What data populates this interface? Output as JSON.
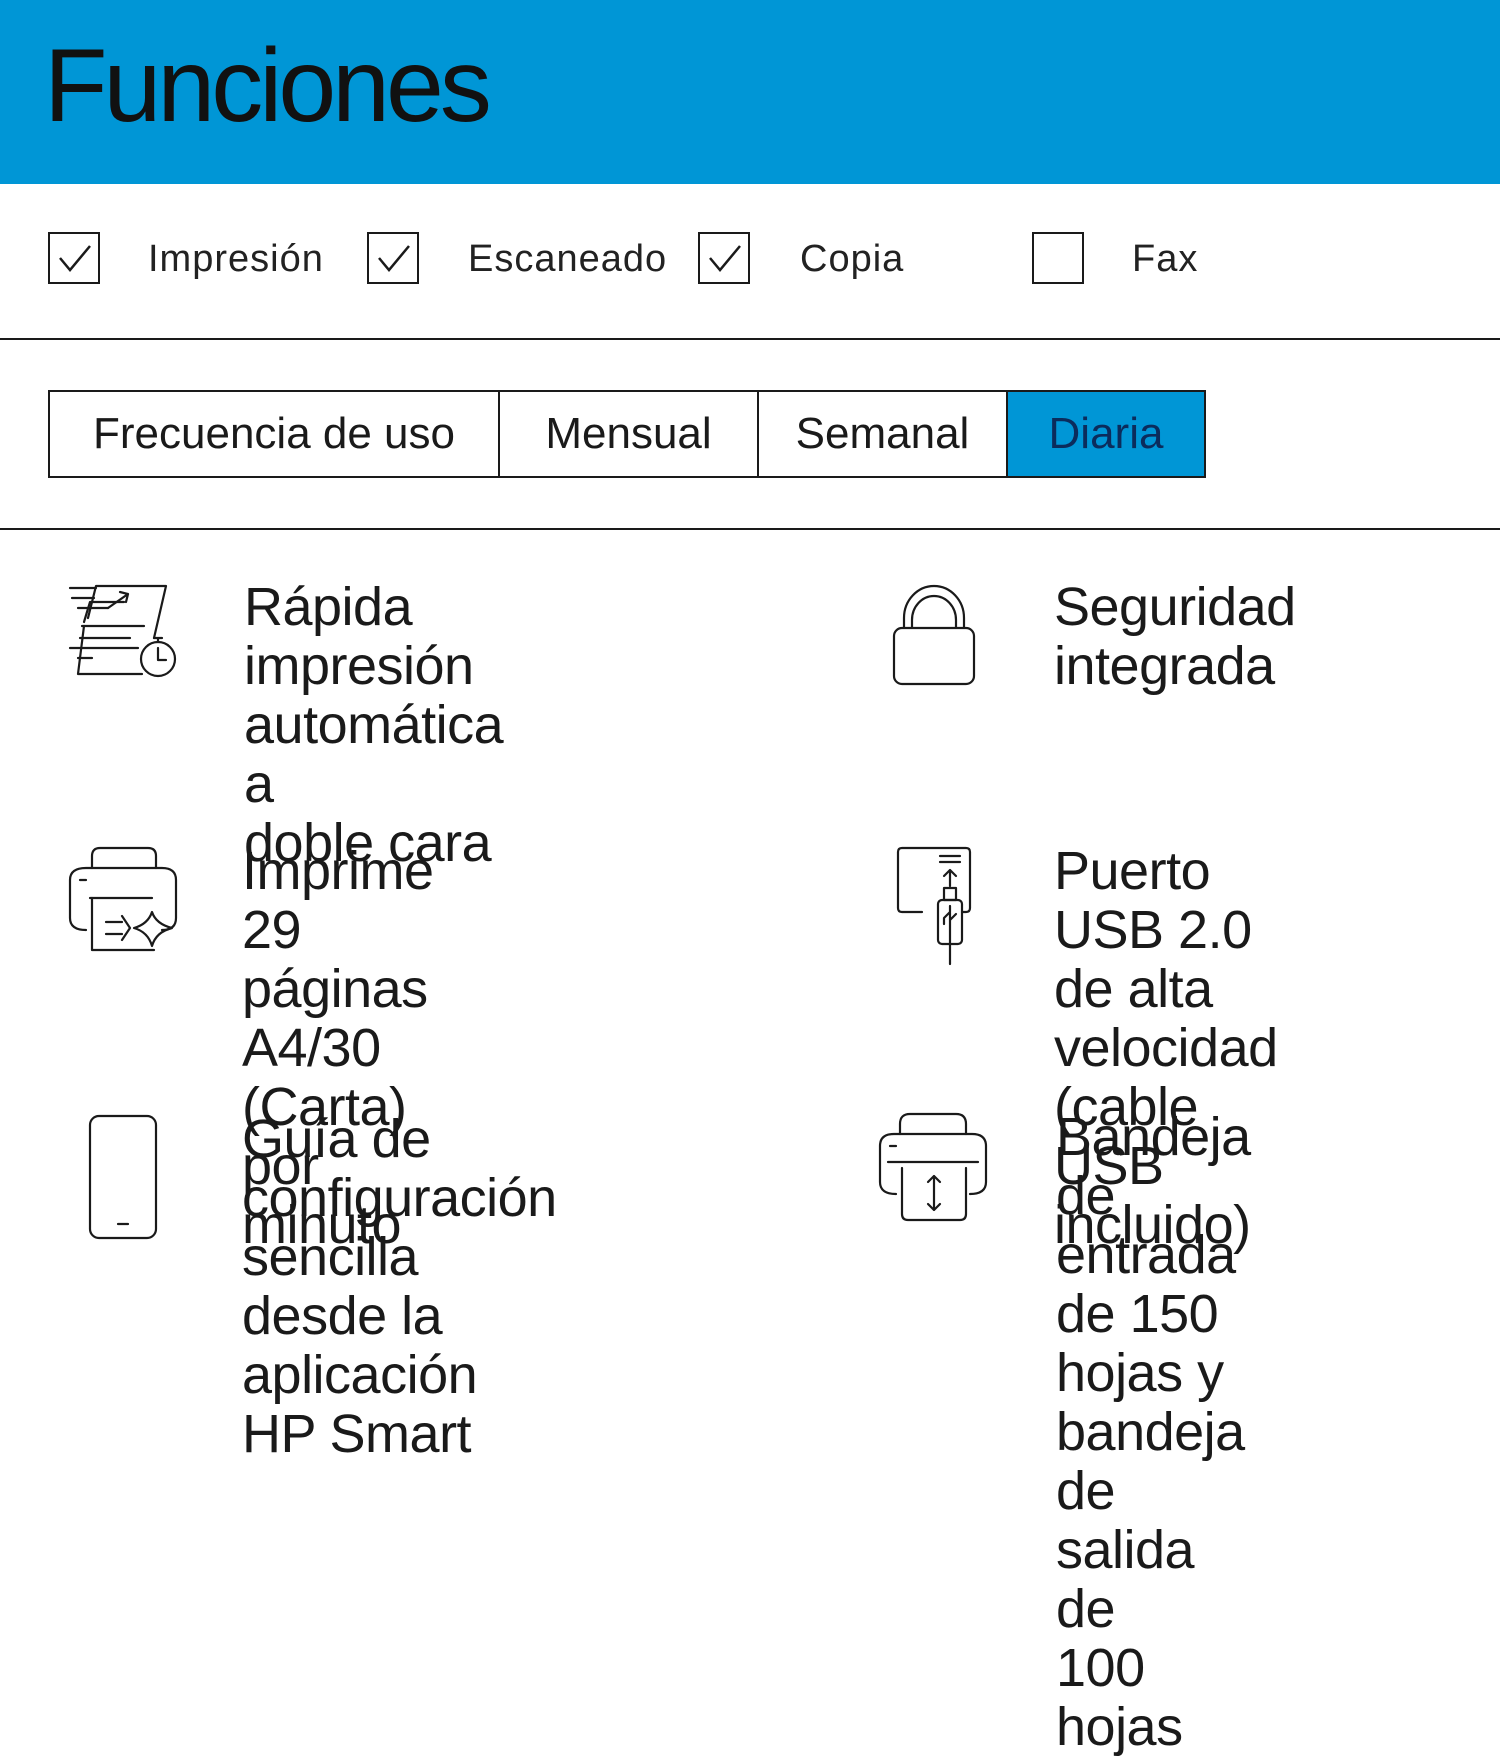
{
  "header": {
    "title": "Funciones"
  },
  "functions": [
    {
      "label": "Impresión",
      "checked": true
    },
    {
      "label": "Escaneado",
      "checked": true
    },
    {
      "label": "Copia",
      "checked": true
    },
    {
      "label": "Fax",
      "checked": false
    }
  ],
  "frequency": {
    "label": "Frecuencia de uso",
    "options": [
      "Mensual",
      "Semanal",
      "Diaria"
    ],
    "selected": "Diaria"
  },
  "colors": {
    "accent": "#0096d6",
    "selected_text": "#0b2c5c",
    "text": "#1a1a1a"
  },
  "features": [
    {
      "icon": "duplex-print-timer-icon",
      "text": "Rápida impresión\nautomática a\ndoble cara"
    },
    {
      "icon": "padlock-icon",
      "text": "Seguridad\nintegrada"
    },
    {
      "icon": "printer-sparkle-icon",
      "text": "Imprime 29 páginas\nA4/30 (Carta) por\nminuto"
    },
    {
      "icon": "usb-port-icon",
      "text": "Puerto USB 2.0\nde alta velocidad\n(cable USB\nincluido)"
    },
    {
      "icon": "smartphone-icon",
      "text": "Guía de configuración\nsencilla desde la\naplicación HP Smart"
    },
    {
      "icon": "printer-tray-icon",
      "text": "Bandeja de\nentrada de 150\nhojas y bandeja\nde salida de\n100 hojas"
    }
  ]
}
